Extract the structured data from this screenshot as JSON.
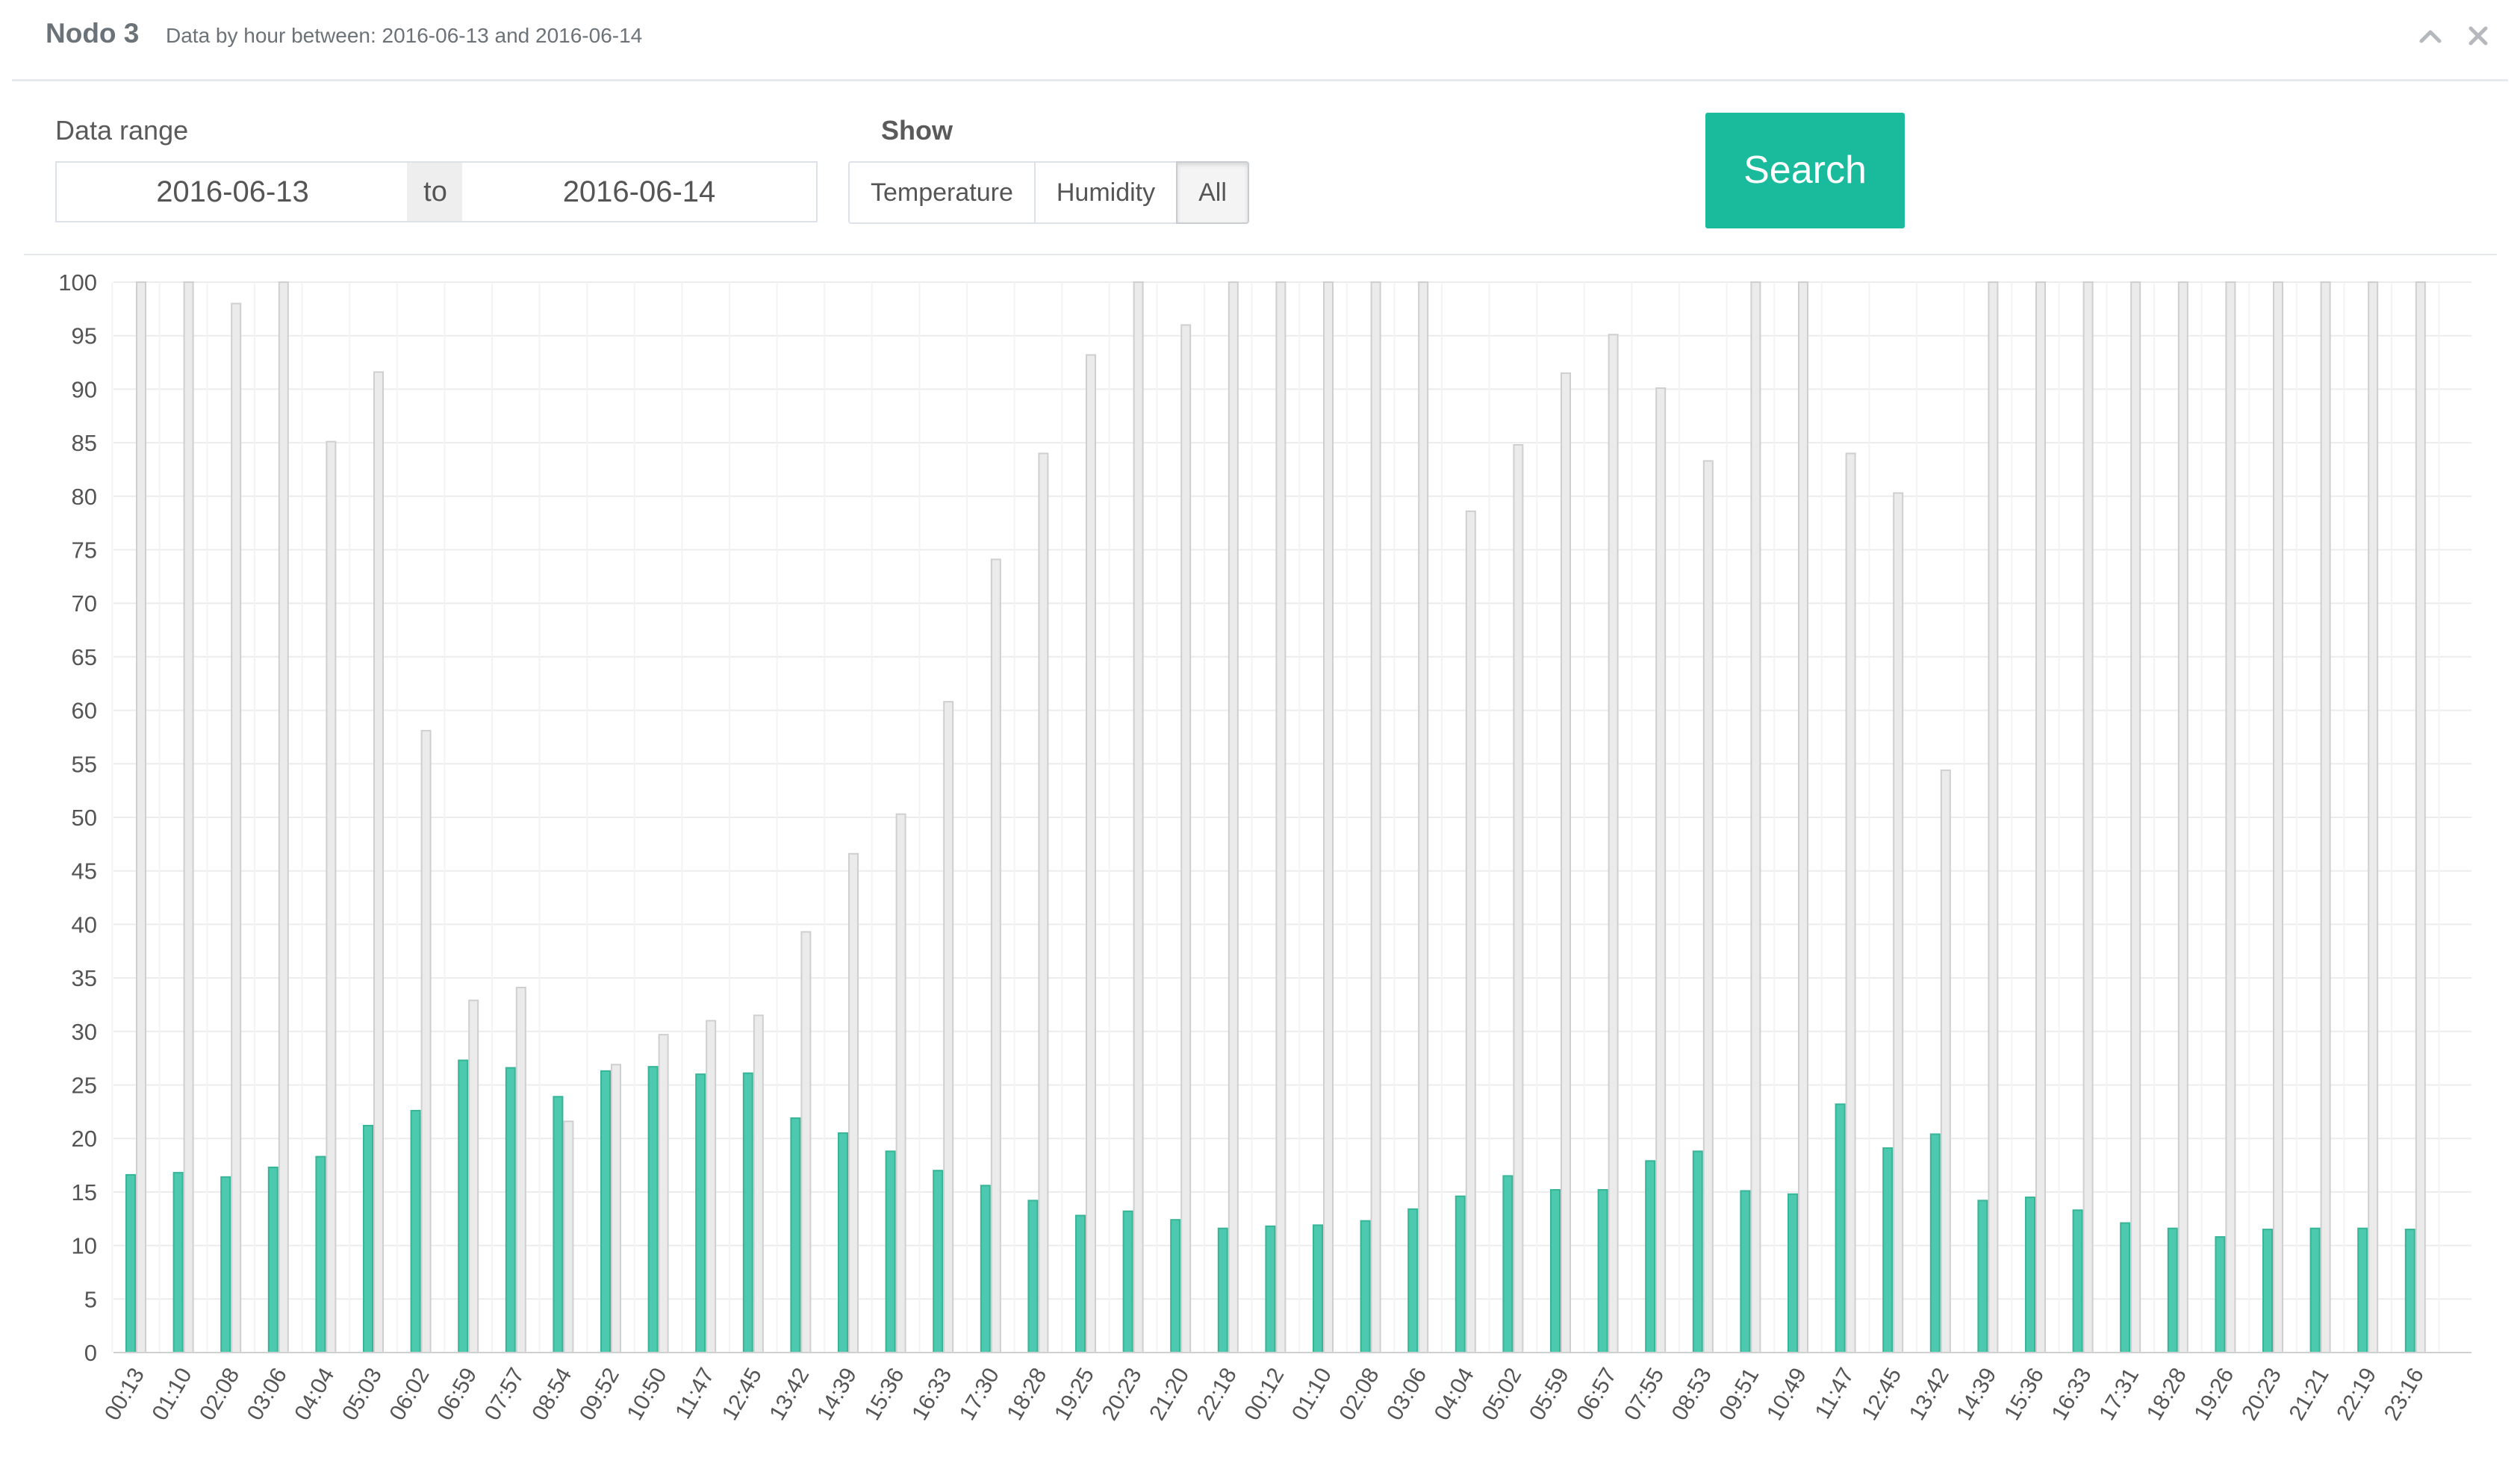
{
  "header": {
    "title": "Nodo 3",
    "subtitle": "Data by hour between: 2016-06-13 and 2016-06-14"
  },
  "form": {
    "range_label": "Data range",
    "from_value": "2016-06-13",
    "to_label": "to",
    "to_value": "2016-06-14",
    "show_label": "Show",
    "options": [
      "Temperature",
      "Humidity",
      "All"
    ],
    "selected": "All",
    "search_label": "Search"
  },
  "colors": {
    "temperature": "#4cc9ae",
    "humidity": "#e2e2e2",
    "accent": "#1abb9c"
  },
  "icons": [
    "chevron-up-icon",
    "close-icon"
  ],
  "chart_data": {
    "type": "bar",
    "categories": [
      "00:13",
      "01:10",
      "02:08",
      "03:06",
      "04:04",
      "05:03",
      "06:02",
      "06:59",
      "07:57",
      "08:54",
      "09:52",
      "10:50",
      "11:47",
      "12:45",
      "13:42",
      "14:39",
      "15:36",
      "16:33",
      "17:30",
      "18:28",
      "19:25",
      "20:23",
      "21:20",
      "22:18",
      "00:12",
      "01:10",
      "02:08",
      "03:06",
      "04:04",
      "05:02",
      "05:59",
      "06:57",
      "07:55",
      "08:53",
      "09:51",
      "10:49",
      "11:47",
      "12:45",
      "13:42",
      "14:39",
      "15:36",
      "16:33",
      "17:31",
      "18:28",
      "19:26",
      "20:23",
      "21:21",
      "22:19",
      "23:16"
    ],
    "series": [
      {
        "values": [
          16.6,
          16.8,
          16.4,
          17.3,
          18.3,
          21.2,
          22.6,
          27.3,
          26.6,
          23.9,
          26.3,
          26.7,
          26.0,
          26.1,
          21.9,
          20.5,
          18.8,
          17.0,
          15.6,
          14.2,
          12.8,
          13.2,
          12.4,
          11.6,
          11.8,
          11.9,
          12.3,
          13.4,
          14.6,
          16.5,
          15.2,
          15.2,
          17.9,
          18.8,
          15.1,
          14.8,
          23.2,
          19.1,
          20.4,
          14.2,
          14.5,
          13.3,
          12.1,
          11.6,
          10.8,
          11.5,
          11.6,
          11.6,
          11.5
        ]
      },
      {
        "values": [
          100,
          100,
          98,
          100,
          85.1,
          91.6,
          58.1,
          32.9,
          34.1,
          21.6,
          26.9,
          29.7,
          31.0,
          31.5,
          39.3,
          46.6,
          50.3,
          60.8,
          74.1,
          84.0,
          93.2,
          100,
          96.0,
          100,
          100,
          100,
          100,
          100,
          78.6,
          84.8,
          91.5,
          95.1,
          90.1,
          83.3,
          100,
          100,
          84.0,
          80.3,
          54.4,
          100,
          100,
          100,
          100,
          100,
          100,
          100,
          100,
          100,
          100
        ]
      }
    ],
    "ylim": [
      0,
      100
    ],
    "yticks": [
      0,
      5,
      10,
      15,
      20,
      25,
      30,
      35,
      40,
      45,
      50,
      55,
      60,
      65,
      70,
      75,
      80,
      85,
      90,
      95,
      100
    ],
    "grid": true
  }
}
